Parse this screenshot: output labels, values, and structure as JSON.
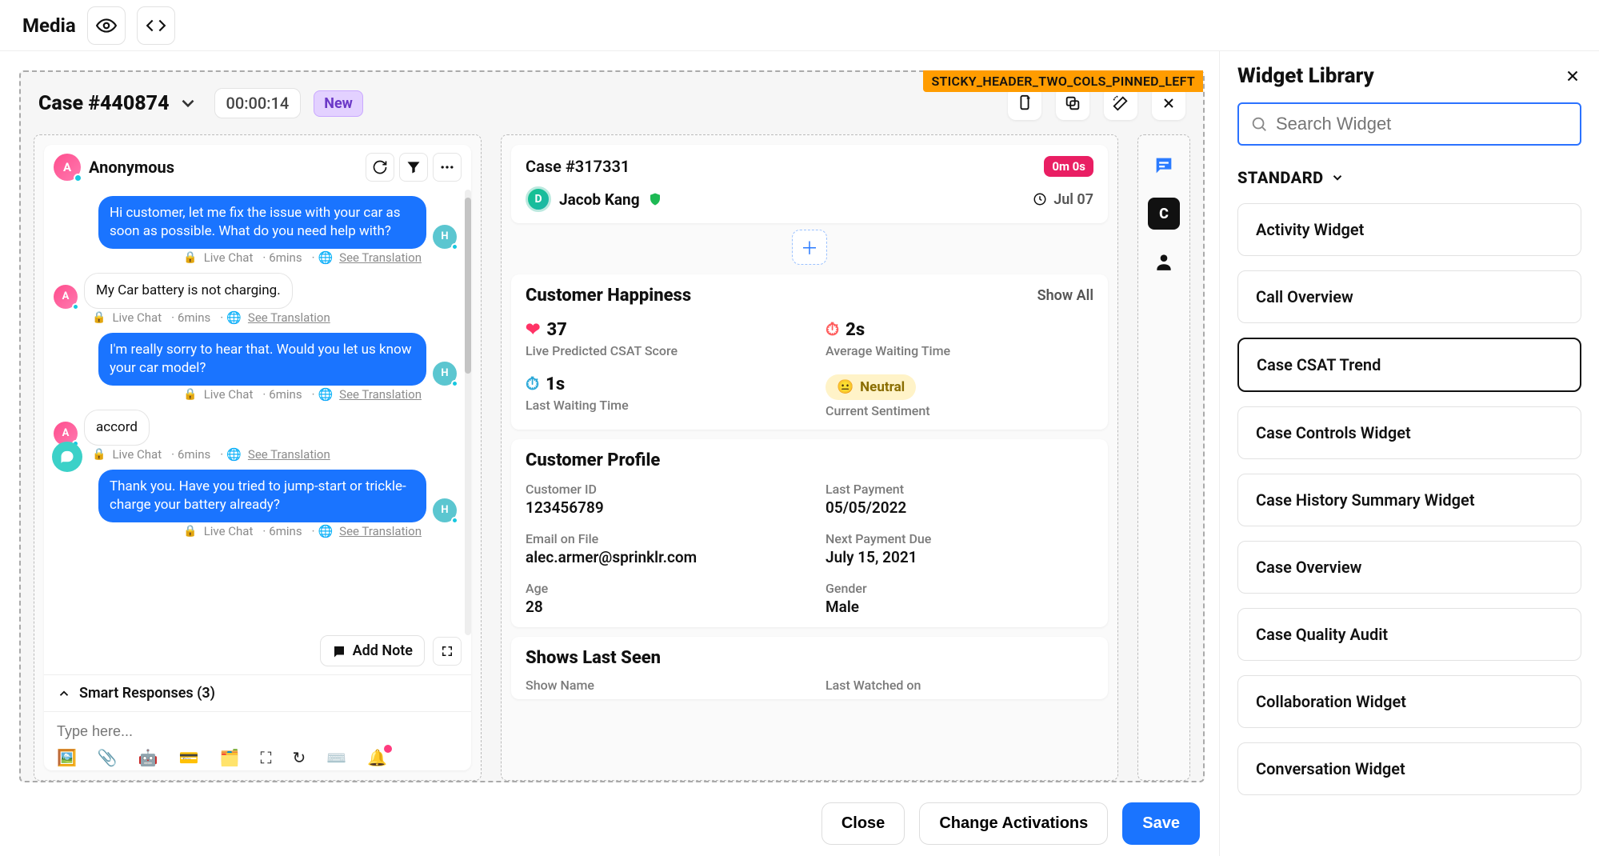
{
  "topbar": {
    "title": "Media"
  },
  "case": {
    "title": "Case #440874",
    "timer": "00:00:14",
    "status": "New",
    "layout_tag": "STICKY_HEADER_TWO_COLS_PINNED_LEFT"
  },
  "chat": {
    "user_name": "Anonymous",
    "user_initial": "A",
    "messages": [
      {
        "from": "agent",
        "initial": "H",
        "text": "Hi customer, let me fix the issue with your car as soon as possible. What do you need help with?",
        "source": "Live Chat",
        "time": "6mins",
        "translate": "See Translation"
      },
      {
        "from": "cust",
        "initial": "A",
        "text": "My Car battery is not charging.",
        "source": "Live Chat",
        "time": "6mins",
        "translate": "See Translation"
      },
      {
        "from": "agent",
        "initial": "H",
        "text": "I'm really sorry to hear that. Would you let us know your car model?",
        "source": "Live Chat",
        "time": "6mins",
        "translate": "See Translation"
      },
      {
        "from": "cust",
        "initial": "A",
        "text": "accord",
        "source": "Live Chat",
        "time": "6mins",
        "translate": "See Translation"
      },
      {
        "from": "agent",
        "initial": "H",
        "text": "Thank you. Have you tried to jump-start or trickle-charge your battery already?",
        "source": "Live Chat",
        "time": "6mins",
        "translate": "See Translation"
      }
    ],
    "add_note": "Add Note",
    "smart_responses": "Smart Responses (3)",
    "compose_placeholder": "Type here..."
  },
  "linked_case": {
    "title": "Case #317331",
    "timer": "0m 0s",
    "agent_initial": "D",
    "agent": "Jacob Kang",
    "date": "Jul 07"
  },
  "happiness": {
    "title": "Customer Happiness",
    "show_all": "Show All",
    "csat_value": "37",
    "csat_label": "Live Predicted CSAT Score",
    "avg_wait_value": "2s",
    "avg_wait_label": "Average Waiting Time",
    "last_wait_value": "1s",
    "last_wait_label": "Last Waiting Time",
    "sentiment_value": "Neutral",
    "sentiment_label": "Current Sentiment"
  },
  "profile": {
    "title": "Customer Profile",
    "customer_id_label": "Customer ID",
    "customer_id_value": "123456789",
    "last_payment_label": "Last Payment",
    "last_payment_value": "05/05/2022",
    "email_label": "Email on File",
    "email_value": "alec.armer@sprinklr.com",
    "next_payment_label": "Next Payment Due",
    "next_payment_value": "July 15, 2021",
    "age_label": "Age",
    "age_value": "28",
    "gender_label": "Gender",
    "gender_value": "Male"
  },
  "shows": {
    "title": "Shows Last Seen",
    "col1": "Show Name",
    "col2": "Last Watched on"
  },
  "library": {
    "title": "Widget Library",
    "search_placeholder": "Search Widget",
    "category": "STANDARD",
    "items": [
      {
        "label": "Activity Widget",
        "selected": false
      },
      {
        "label": "Call Overview",
        "selected": false
      },
      {
        "label": "Case CSAT Trend",
        "selected": true
      },
      {
        "label": "Case Controls Widget",
        "selected": false
      },
      {
        "label": "Case History Summary Widget",
        "selected": false
      },
      {
        "label": "Case Overview",
        "selected": false
      },
      {
        "label": "Case Quality Audit",
        "selected": false
      },
      {
        "label": "Collaboration Widget",
        "selected": false
      },
      {
        "label": "Conversation Widget",
        "selected": false
      }
    ]
  },
  "actions": {
    "close": "Close",
    "change": "Change Activations",
    "save": "Save"
  }
}
